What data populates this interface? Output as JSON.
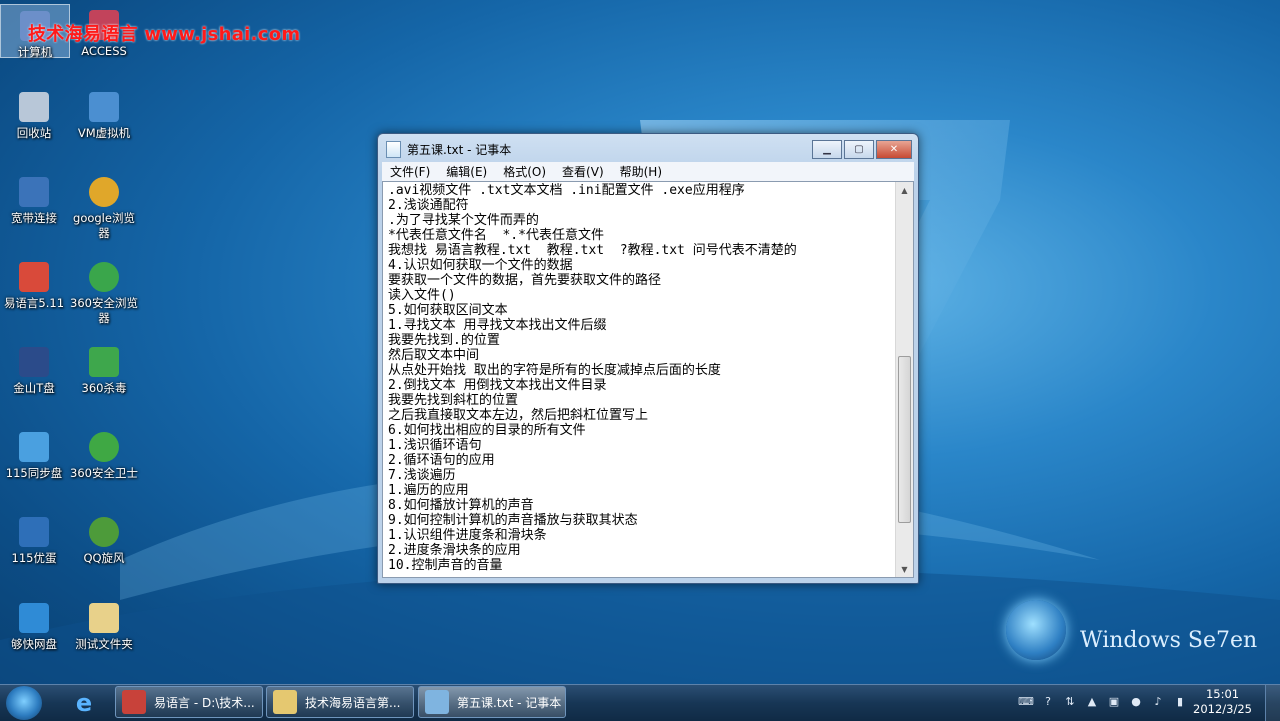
{
  "watermark": "技术海易语言 www.jshai.com",
  "desktop_icons": [
    {
      "label": "计算机",
      "color": "#6c8fc9"
    },
    {
      "label": "ACCESS",
      "color": "#c2435b"
    },
    {
      "label": "回收站",
      "color": "#b8c7d8"
    },
    {
      "label": "VM虚拟机",
      "color": "#4b8fd1"
    },
    {
      "label": "宽带连接",
      "color": "#3b73b9"
    },
    {
      "label": "google浏览器",
      "color": "#e0a72a"
    },
    {
      "label": "易语言5.11",
      "color": "#d94a3a"
    },
    {
      "label": "360安全浏览器",
      "color": "#3aa64b"
    },
    {
      "label": "金山T盘",
      "color": "#2b4b8a"
    },
    {
      "label": "360杀毒",
      "color": "#3ea74c"
    },
    {
      "label": "115同步盘",
      "color": "#4aa0e0"
    },
    {
      "label": "360安全卫士",
      "color": "#3fa844"
    },
    {
      "label": "115优蛋",
      "color": "#2e6fb8"
    },
    {
      "label": "QQ旋风",
      "color": "#4d9b3a"
    },
    {
      "label": "够快网盘",
      "color": "#2f8bd6"
    },
    {
      "label": "测试文件夹",
      "color": "#e8d18a"
    }
  ],
  "notepad": {
    "title": "第五课.txt - 记事本",
    "menus": [
      "文件(F)",
      "编辑(E)",
      "格式(O)",
      "查看(V)",
      "帮助(H)"
    ],
    "lines": [
      ".avi视频文件 .txt文本文档 .ini配置文件 .exe应用程序",
      "2.浅谈通配符",
      ".为了寻找某个文件而弄的",
      "*代表任意文件名  *.*代表任意文件",
      "我想找 易语言教程.txt  教程.txt  ?教程.txt 问号代表不清楚的",
      "4.认识如何获取一个文件的数据",
      "要获取一个文件的数据，首先要获取文件的路径",
      "读入文件()",
      "5.如何获取区间文本",
      "1.寻找文本 用寻找文本找出文件后缀",
      "我要先找到.的位置",
      "然后取文本中间",
      "从点处开始找 取出的字符是所有的长度减掉点后面的长度",
      "2.倒找文本 用倒找文本找出文件目录",
      "我要先找到斜杠的位置",
      "之后我直接取文本左边，然后把斜杠位置写上",
      "6.如何找出相应的目录的所有文件",
      "1.浅识循环语句",
      "2.循环语句的应用",
      "7.浅谈遍历",
      "1.遍历的应用",
      "8.如何播放计算机的声音",
      "9.如何控制计算机的声音播放与获取其状态",
      "1.认识组件进度条和滑块条",
      "2.进度条滑块条的应用",
      "10.控制声音的音量"
    ]
  },
  "brand": "Windows Se7en",
  "taskbar": {
    "tasks": [
      {
        "label": "易语言 - D:\\技术...",
        "color": "#c8423a"
      },
      {
        "label": "技术海易语言第...",
        "color": "#e5c870"
      },
      {
        "label": "第五课.txt - 记事本",
        "color": "#7fb4e0"
      }
    ],
    "time": "15:01",
    "date": "2012/3/25"
  }
}
